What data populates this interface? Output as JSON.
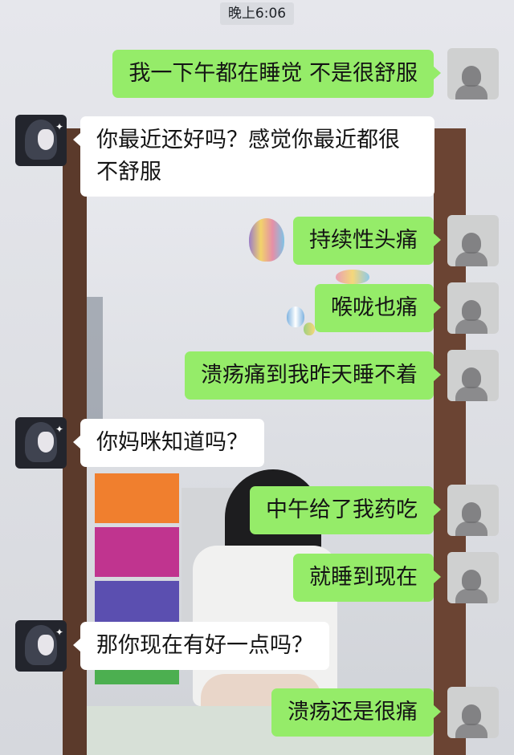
{
  "timestamp": "晚上6:06",
  "colors": {
    "self_bubble": "#95ec69",
    "other_bubble": "#ffffff",
    "text": "#141414"
  },
  "icons": {
    "self_avatar": "silhouette-avatar-icon",
    "other_avatar": "anime-girl-avatar-icon"
  },
  "messages": [
    {
      "sender": "self",
      "text": "我一下午都在睡觉 不是很舒服"
    },
    {
      "sender": "other",
      "text": "你最近还好吗？感觉你最近都很不舒服"
    },
    {
      "sender": "self",
      "text": "持续性头痛"
    },
    {
      "sender": "self",
      "text": "喉咙也痛"
    },
    {
      "sender": "self",
      "text": "溃疡痛到我昨天睡不着"
    },
    {
      "sender": "other",
      "text": "你妈咪知道吗？"
    },
    {
      "sender": "self",
      "text": "中午给了我药吃"
    },
    {
      "sender": "self",
      "text": "就睡到现在"
    },
    {
      "sender": "other",
      "text": "那你现在有好一点吗？"
    },
    {
      "sender": "self",
      "text": "溃疡还是很痛"
    }
  ]
}
